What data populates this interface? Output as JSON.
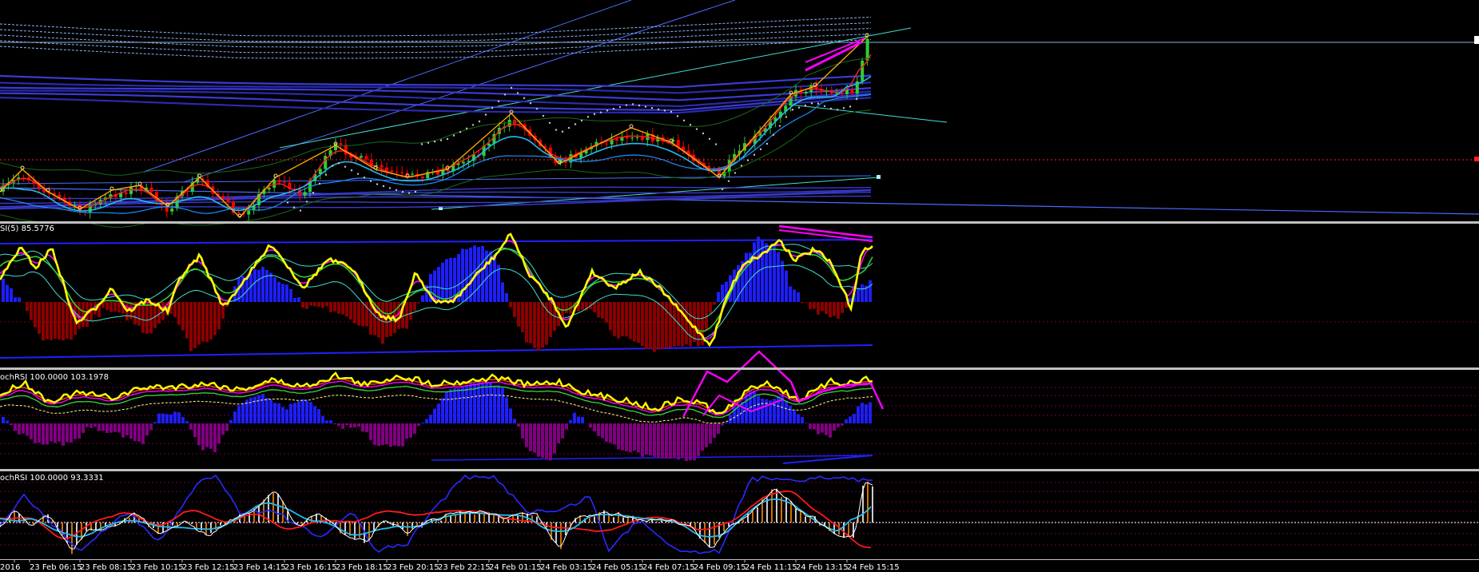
{
  "indicators": {
    "rsi_label": "SI(5) 85.5776",
    "stochrsi_1_label": "ochRSI 100.0000 103.1978",
    "stochrsi_2_label": "ochRSI 100.0000 93.3331"
  },
  "time_axis": {
    "labels": [
      "2016",
      "23 Feb 06:15",
      "23 Feb 08:15",
      "23 Feb 10:15",
      "23 Feb 12:15",
      "23 Feb 14:15",
      "23 Feb 16:15",
      "23 Feb 18:15",
      "23 Feb 20:15",
      "23 Feb 22:15",
      "24 Feb 01:15",
      "24 Feb 03:15",
      "24 Feb 05:15",
      "24 Feb 07:15",
      "24 Feb 09:15",
      "24 Feb 11:15",
      "24 Feb 13:15",
      "24 Feb 15:15"
    ]
  },
  "colors": {
    "background": "#000000",
    "candle_up": "#32cd32",
    "candle_down": "#ff0000",
    "rsi_line": "#ffff00",
    "histogram_positive": "#1e1eff",
    "histogram_negative_rsi": "#8b0000",
    "histogram_negative_stoch": "#800080",
    "trend_magenta": "#ff00ff",
    "separator": "#c0c0c0"
  }
}
